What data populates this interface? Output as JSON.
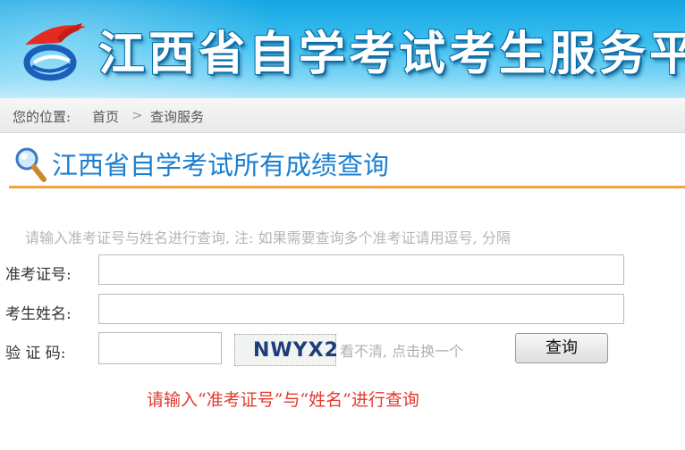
{
  "banner": {
    "title": "江西省自学考试考生服务平台"
  },
  "breadcrumb": {
    "prefix": "您的位置:",
    "home": "首页",
    "separator": ">",
    "current": "查询服务"
  },
  "section": {
    "title": "江西省自学考试所有成绩查询"
  },
  "form": {
    "hint": "请输入准考证号与姓名进行查询, 注: 如果需要查询多个准考证请用逗号, 分隔",
    "ticket_label": "准考证号:",
    "ticket_value": "",
    "name_label": "考生姓名:",
    "name_value": "",
    "code_label": "验 证 码:",
    "code_value": "",
    "captcha_text": "NWYX2",
    "refresh_text": "看不清, 点击换一个",
    "submit_label": "查询"
  },
  "notice": "请输入“准考证号”与“姓名”进行查询",
  "colors": {
    "banner": "#3cc0f0",
    "title_blue": "#1b7fd0",
    "underline_orange": "#f2a33a",
    "notice_red": "#e23a2e"
  }
}
